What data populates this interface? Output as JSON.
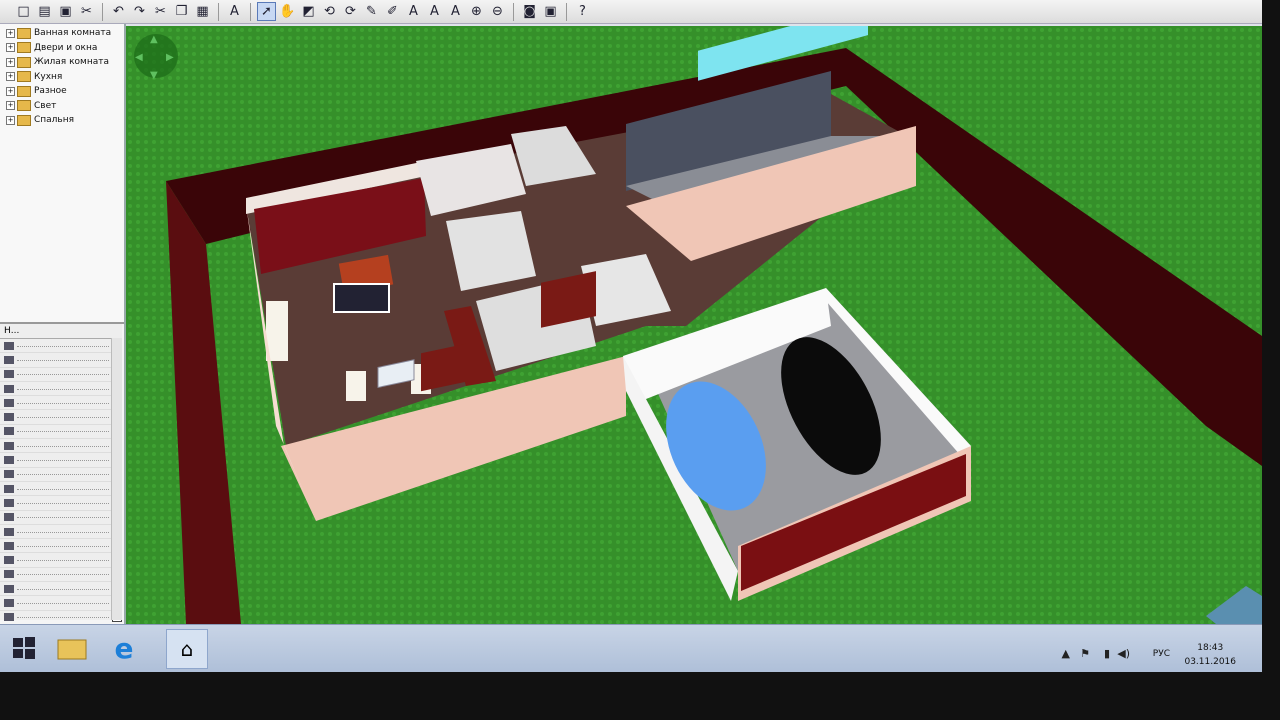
{
  "toolbar": {
    "icons": [
      "new-icon",
      "open-icon",
      "save-icon",
      "print-icon",
      "cut-icon",
      "undo-icon",
      "redo-icon",
      "scissors-icon",
      "copy-icon",
      "paste-icon",
      "text-icon",
      "pointer-icon",
      "hand-icon",
      "view-icon",
      "rotate-icon",
      "rotate-right-icon",
      "tag-icon",
      "tag2-icon",
      "text-a-icon",
      "text-a2-icon",
      "text-a3-icon",
      "zoom-in-icon",
      "zoom-out-icon",
      "camera-icon",
      "screenshot-icon",
      "help-icon"
    ]
  },
  "catalog": {
    "items": [
      {
        "label": "Ванная комната"
      },
      {
        "label": "Двери и окна"
      },
      {
        "label": "Жилая комната"
      },
      {
        "label": "Кухня"
      },
      {
        "label": "Разное"
      },
      {
        "label": "Свет"
      },
      {
        "label": "Спальня"
      }
    ]
  },
  "layers": {
    "header": "Н...",
    "row_count": 22
  },
  "taskbar": {
    "language": "РУС",
    "time": "18:43",
    "date": "03.11.2016"
  },
  "colors": {
    "grass": "#2e7f20",
    "wall_outer": "#f0c6b6",
    "wall_dark": "#6b0f14",
    "floor": "#5a3c36"
  }
}
